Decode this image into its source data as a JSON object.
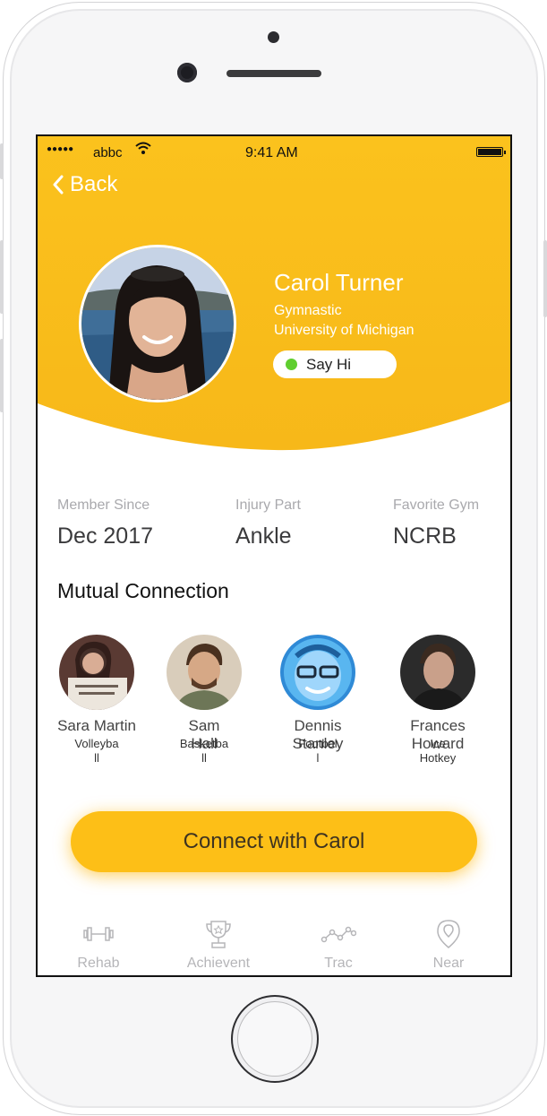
{
  "status_bar": {
    "signal": "●●●●●",
    "carrier": "abbc",
    "time": "9:41 AM"
  },
  "nav": {
    "back_label": "Back"
  },
  "profile": {
    "name": "Carol Turner",
    "sport": "Gymnastic",
    "school": "University of Michigan",
    "say_hi_label": "Say Hi",
    "online_color": "#5fce2f"
  },
  "stats": [
    {
      "label": "Member Since",
      "value": "Dec 2017"
    },
    {
      "label": "Injury Part",
      "value": "Ankle"
    },
    {
      "label": "Favorite Gym",
      "value": "NCRB"
    }
  ],
  "mutual": {
    "title": "Mutual Connection",
    "people": [
      {
        "name": "Sara Martin",
        "sport": "Volleyba\nll"
      },
      {
        "name": "Sam\nHall",
        "sport": "Basketba\nll"
      },
      {
        "name": "Dennis\nStanley",
        "sport": "Footbal\nl"
      },
      {
        "name": "Frances\nHoward",
        "sport": "Ice\nHotkey"
      }
    ]
  },
  "cta": {
    "label": "Connect with Carol"
  },
  "tabs": [
    {
      "label": "Rehab",
      "icon": "dumbbell-icon"
    },
    {
      "label": "Achievent",
      "icon": "trophy-icon"
    },
    {
      "label": "Trac",
      "icon": "trend-icon"
    },
    {
      "label": "Near",
      "icon": "location-pin-icon"
    }
  ],
  "colors": {
    "accent": "#f9bd17",
    "button": "#fdbf17",
    "tab_inactive": "#b5b5b8"
  }
}
